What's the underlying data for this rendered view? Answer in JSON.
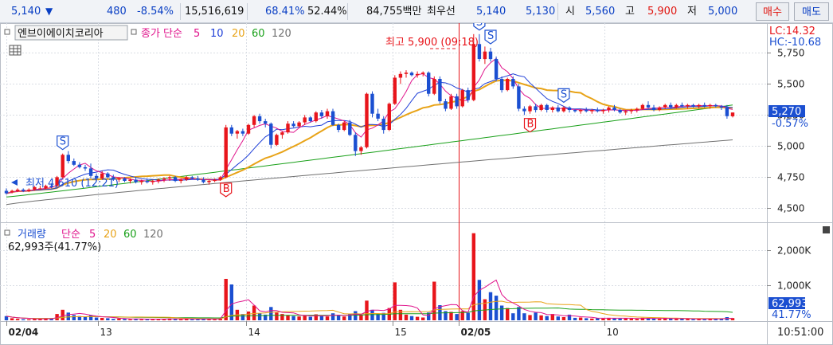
{
  "quote_bar": {
    "price": "5,140",
    "change_arrow": "▼",
    "change": "480",
    "change_pct": "-8.54%",
    "volume": "15,516,619",
    "ratio1": "68.41%",
    "ratio2": "52.44%",
    "amount": "84,755백만",
    "best_label": "최우선",
    "best_ask": "5,140",
    "best_bid": "5,130",
    "open_label": "시",
    "open": "5,560",
    "high_label": "고",
    "high": "5,900",
    "low_label": "저",
    "low": "5,000",
    "buy_button": "매수",
    "sell_button": "매도"
  },
  "price_panel": {
    "stock_name": "엔브이에이치코리아",
    "ma_label": "종가 단순",
    "ma_periods": [
      "5",
      "10",
      "20",
      "60",
      "120"
    ],
    "lc_label": "LC:14.32",
    "hc_label": "HC:-10.68",
    "high_annotation": "최고 5,900 (09:18)",
    "low_annotation": "최저 4,610 (12:21)",
    "current_price_tag": "5,270",
    "current_pct_tag": "-0.57%",
    "y_ticks": [
      "5,750",
      "5,500",
      "5,250",
      "5,000",
      "4,750",
      "4,500"
    ],
    "signal_buy": "B",
    "signal_sell": "S"
  },
  "volume_panel": {
    "title": "거래량",
    "ma_label": "단순",
    "ma_periods": [
      "5",
      "20",
      "60",
      "120"
    ],
    "info": "62,993주(41.77%)",
    "current_tag": "62,993",
    "current_pct_tag": "41.77%",
    "y_ticks": [
      "2,000K",
      "1,000K"
    ]
  },
  "x_axis": {
    "labels": [
      "02/04",
      "13",
      "14",
      "15",
      "02/05",
      "10"
    ],
    "time": "10:51:00"
  },
  "colors": {
    "up": "#e8151b",
    "down": "#1b4fd1",
    "ma5": "#e0148c",
    "ma10": "#2040d8",
    "ma20": "#e8a317",
    "ma60": "#19a019",
    "ma120": "#707070"
  },
  "chart_data": {
    "type": "candlestick",
    "price_ylim": [
      4400,
      5950
    ],
    "volume_ylim": [
      0,
      2700000
    ],
    "candles": [
      {
        "o": 4640,
        "h": 4660,
        "l": 4610,
        "c": 4620,
        "v": 120000
      },
      {
        "o": 4630,
        "h": 4650,
        "l": 4620,
        "c": 4640,
        "v": 60000
      },
      {
        "o": 4640,
        "h": 4660,
        "l": 4630,
        "c": 4650,
        "v": 40000
      },
      {
        "o": 4650,
        "h": 4660,
        "l": 4630,
        "c": 4640,
        "v": 30000
      },
      {
        "o": 4640,
        "h": 4660,
        "l": 4630,
        "c": 4650,
        "v": 30000
      },
      {
        "o": 4650,
        "h": 4680,
        "l": 4640,
        "c": 4670,
        "v": 50000
      },
      {
        "o": 4660,
        "h": 4680,
        "l": 4650,
        "c": 4660,
        "v": 40000
      },
      {
        "o": 4660,
        "h": 4690,
        "l": 4650,
        "c": 4680,
        "v": 60000
      },
      {
        "o": 4680,
        "h": 4700,
        "l": 4660,
        "c": 4670,
        "v": 40000
      },
      {
        "o": 4680,
        "h": 4760,
        "l": 4670,
        "c": 4750,
        "v": 180000
      },
      {
        "o": 4750,
        "h": 4940,
        "l": 4740,
        "c": 4930,
        "v": 300000
      },
      {
        "o": 4930,
        "h": 4960,
        "l": 4860,
        "c": 4880,
        "v": 220000
      },
      {
        "o": 4880,
        "h": 4900,
        "l": 4840,
        "c": 4850,
        "v": 150000
      },
      {
        "o": 4850,
        "h": 4870,
        "l": 4820,
        "c": 4830,
        "v": 120000
      },
      {
        "o": 4830,
        "h": 4850,
        "l": 4800,
        "c": 4820,
        "v": 90000
      },
      {
        "o": 4820,
        "h": 4860,
        "l": 4740,
        "c": 4760,
        "v": 150000
      },
      {
        "o": 4760,
        "h": 4780,
        "l": 4720,
        "c": 4740,
        "v": 80000
      },
      {
        "o": 4740,
        "h": 4800,
        "l": 4730,
        "c": 4780,
        "v": 70000
      },
      {
        "o": 4780,
        "h": 4790,
        "l": 4740,
        "c": 4750,
        "v": 60000
      },
      {
        "o": 4750,
        "h": 4770,
        "l": 4720,
        "c": 4730,
        "v": 40000
      },
      {
        "o": 4730,
        "h": 4750,
        "l": 4710,
        "c": 4740,
        "v": 50000
      },
      {
        "o": 4740,
        "h": 4750,
        "l": 4710,
        "c": 4720,
        "v": 40000
      },
      {
        "o": 4720,
        "h": 4740,
        "l": 4700,
        "c": 4730,
        "v": 30000
      },
      {
        "o": 4730,
        "h": 4750,
        "l": 4700,
        "c": 4710,
        "v": 40000
      },
      {
        "o": 4710,
        "h": 4730,
        "l": 4690,
        "c": 4720,
        "v": 30000
      },
      {
        "o": 4720,
        "h": 4740,
        "l": 4700,
        "c": 4710,
        "v": 30000
      },
      {
        "o": 4710,
        "h": 4730,
        "l": 4690,
        "c": 4720,
        "v": 40000
      },
      {
        "o": 4720,
        "h": 4740,
        "l": 4700,
        "c": 4730,
        "v": 30000
      },
      {
        "o": 4730,
        "h": 4750,
        "l": 4710,
        "c": 4740,
        "v": 40000
      },
      {
        "o": 4740,
        "h": 4760,
        "l": 4720,
        "c": 4750,
        "v": 50000
      },
      {
        "o": 4750,
        "h": 4760,
        "l": 4710,
        "c": 4720,
        "v": 40000
      },
      {
        "o": 4720,
        "h": 4740,
        "l": 4700,
        "c": 4730,
        "v": 30000
      },
      {
        "o": 4730,
        "h": 4760,
        "l": 4720,
        "c": 4750,
        "v": 40000
      },
      {
        "o": 4750,
        "h": 4760,
        "l": 4730,
        "c": 4740,
        "v": 30000
      },
      {
        "o": 4740,
        "h": 4760,
        "l": 4720,
        "c": 4730,
        "v": 30000
      },
      {
        "o": 4730,
        "h": 4750,
        "l": 4700,
        "c": 4710,
        "v": 50000
      },
      {
        "o": 4710,
        "h": 4730,
        "l": 4690,
        "c": 4720,
        "v": 40000
      },
      {
        "o": 4720,
        "h": 4740,
        "l": 4710,
        "c": 4730,
        "v": 30000
      },
      {
        "o": 4730,
        "h": 4760,
        "l": 4720,
        "c": 4750,
        "v": 50000
      },
      {
        "o": 4750,
        "h": 5170,
        "l": 4740,
        "c": 5150,
        "v": 1180000
      },
      {
        "o": 5150,
        "h": 5170,
        "l": 5080,
        "c": 5100,
        "v": 1020000
      },
      {
        "o": 5100,
        "h": 5130,
        "l": 5060,
        "c": 5120,
        "v": 300000
      },
      {
        "o": 5120,
        "h": 5140,
        "l": 5080,
        "c": 5100,
        "v": 180000
      },
      {
        "o": 5100,
        "h": 5180,
        "l": 5090,
        "c": 5170,
        "v": 250000
      },
      {
        "o": 5170,
        "h": 5250,
        "l": 5150,
        "c": 5240,
        "v": 420000
      },
      {
        "o": 5240,
        "h": 5260,
        "l": 5180,
        "c": 5200,
        "v": 200000
      },
      {
        "o": 5200,
        "h": 5220,
        "l": 5150,
        "c": 5180,
        "v": 160000
      },
      {
        "o": 5180,
        "h": 5190,
        "l": 4980,
        "c": 5010,
        "v": 380000
      },
      {
        "o": 5010,
        "h": 5100,
        "l": 5000,
        "c": 5090,
        "v": 220000
      },
      {
        "o": 5090,
        "h": 5120,
        "l": 5060,
        "c": 5110,
        "v": 180000
      },
      {
        "o": 5110,
        "h": 5200,
        "l": 5100,
        "c": 5180,
        "v": 150000
      },
      {
        "o": 5180,
        "h": 5200,
        "l": 5150,
        "c": 5160,
        "v": 120000
      },
      {
        "o": 5160,
        "h": 5200,
        "l": 5150,
        "c": 5190,
        "v": 110000
      },
      {
        "o": 5190,
        "h": 5250,
        "l": 5170,
        "c": 5230,
        "v": 130000
      },
      {
        "o": 5230,
        "h": 5240,
        "l": 5190,
        "c": 5200,
        "v": 100000
      },
      {
        "o": 5200,
        "h": 5280,
        "l": 5190,
        "c": 5270,
        "v": 170000
      },
      {
        "o": 5270,
        "h": 5290,
        "l": 5220,
        "c": 5240,
        "v": 120000
      },
      {
        "o": 5240,
        "h": 5300,
        "l": 5220,
        "c": 5280,
        "v": 110000
      },
      {
        "o": 5280,
        "h": 5300,
        "l": 5160,
        "c": 5170,
        "v": 200000
      },
      {
        "o": 5170,
        "h": 5180,
        "l": 5110,
        "c": 5130,
        "v": 140000
      },
      {
        "o": 5130,
        "h": 5200,
        "l": 5120,
        "c": 5190,
        "v": 110000
      },
      {
        "o": 5190,
        "h": 5210,
        "l": 5080,
        "c": 5090,
        "v": 180000
      },
      {
        "o": 5090,
        "h": 5110,
        "l": 4920,
        "c": 4960,
        "v": 260000
      },
      {
        "o": 4960,
        "h": 5000,
        "l": 4930,
        "c": 4990,
        "v": 150000
      },
      {
        "o": 4990,
        "h": 5430,
        "l": 4980,
        "c": 5420,
        "v": 560000
      },
      {
        "o": 5420,
        "h": 5440,
        "l": 5230,
        "c": 5260,
        "v": 300000
      },
      {
        "o": 5260,
        "h": 5300,
        "l": 5200,
        "c": 5220,
        "v": 180000
      },
      {
        "o": 5220,
        "h": 5240,
        "l": 5100,
        "c": 5130,
        "v": 210000
      },
      {
        "o": 5130,
        "h": 5350,
        "l": 5120,
        "c": 5340,
        "v": 350000
      },
      {
        "o": 5340,
        "h": 5570,
        "l": 5330,
        "c": 5550,
        "v": 1080000
      },
      {
        "o": 5550,
        "h": 5600,
        "l": 5500,
        "c": 5580,
        "v": 300000
      },
      {
        "o": 5580,
        "h": 5610,
        "l": 5550,
        "c": 5590,
        "v": 160000
      },
      {
        "o": 5590,
        "h": 5600,
        "l": 5560,
        "c": 5570,
        "v": 120000
      },
      {
        "o": 5570,
        "h": 5600,
        "l": 5550,
        "c": 5580,
        "v": 100000
      },
      {
        "o": 5580,
        "h": 5600,
        "l": 5560,
        "c": 5590,
        "v": 80000
      },
      {
        "o": 5590,
        "h": 5600,
        "l": 5400,
        "c": 5420,
        "v": 220000
      },
      {
        "o": 5420,
        "h": 5560,
        "l": 5410,
        "c": 5540,
        "v": 1100000
      },
      {
        "o": 5540,
        "h": 5560,
        "l": 5340,
        "c": 5360,
        "v": 430000
      },
      {
        "o": 5360,
        "h": 5380,
        "l": 5280,
        "c": 5300,
        "v": 260000
      },
      {
        "o": 5300,
        "h": 5420,
        "l": 5290,
        "c": 5400,
        "v": 240000
      },
      {
        "o": 5400,
        "h": 5420,
        "l": 5300,
        "c": 5320,
        "v": 180000
      },
      {
        "o": 5320,
        "h": 5460,
        "l": 5310,
        "c": 5450,
        "v": 260000
      },
      {
        "o": 5450,
        "h": 5470,
        "l": 5350,
        "c": 5370,
        "v": 210000
      },
      {
        "o": 5370,
        "h": 5900,
        "l": 5360,
        "c": 5820,
        "v": 2480000
      },
      {
        "o": 5820,
        "h": 5900,
        "l": 5680,
        "c": 5700,
        "v": 1150000
      },
      {
        "o": 5700,
        "h": 5800,
        "l": 5660,
        "c": 5760,
        "v": 600000
      },
      {
        "o": 5760,
        "h": 5790,
        "l": 5680,
        "c": 5700,
        "v": 800000
      },
      {
        "o": 5700,
        "h": 5720,
        "l": 5520,
        "c": 5540,
        "v": 700000
      },
      {
        "o": 5540,
        "h": 5560,
        "l": 5430,
        "c": 5450,
        "v": 420000
      },
      {
        "o": 5450,
        "h": 5550,
        "l": 5440,
        "c": 5540,
        "v": 350000
      },
      {
        "o": 5540,
        "h": 5560,
        "l": 5460,
        "c": 5480,
        "v": 200000
      },
      {
        "o": 5480,
        "h": 5500,
        "l": 5280,
        "c": 5300,
        "v": 380000
      },
      {
        "o": 5300,
        "h": 5320,
        "l": 5250,
        "c": 5280,
        "v": 200000
      },
      {
        "o": 5280,
        "h": 5330,
        "l": 5260,
        "c": 5320,
        "v": 150000
      },
      {
        "o": 5320,
        "h": 5340,
        "l": 5270,
        "c": 5290,
        "v": 220000
      },
      {
        "o": 5290,
        "h": 5340,
        "l": 5280,
        "c": 5330,
        "v": 140000
      },
      {
        "o": 5330,
        "h": 5340,
        "l": 5270,
        "c": 5290,
        "v": 120000
      },
      {
        "o": 5290,
        "h": 5320,
        "l": 5270,
        "c": 5310,
        "v": 180000
      },
      {
        "o": 5310,
        "h": 5330,
        "l": 5270,
        "c": 5280,
        "v": 110000
      },
      {
        "o": 5280,
        "h": 5320,
        "l": 5270,
        "c": 5310,
        "v": 90000
      },
      {
        "o": 5310,
        "h": 5320,
        "l": 5270,
        "c": 5290,
        "v": 160000
      },
      {
        "o": 5290,
        "h": 5300,
        "l": 5270,
        "c": 5280,
        "v": 70000
      },
      {
        "o": 5280,
        "h": 5300,
        "l": 5260,
        "c": 5290,
        "v": 80000
      },
      {
        "o": 5290,
        "h": 5310,
        "l": 5270,
        "c": 5280,
        "v": 60000
      },
      {
        "o": 5280,
        "h": 5300,
        "l": 5260,
        "c": 5290,
        "v": 50000
      },
      {
        "o": 5290,
        "h": 5310,
        "l": 5270,
        "c": 5280,
        "v": 60000
      },
      {
        "o": 5280,
        "h": 5300,
        "l": 5260,
        "c": 5290,
        "v": 50000
      },
      {
        "o": 5290,
        "h": 5320,
        "l": 5270,
        "c": 5310,
        "v": 70000
      },
      {
        "o": 5310,
        "h": 5330,
        "l": 5280,
        "c": 5290,
        "v": 60000
      },
      {
        "o": 5290,
        "h": 5300,
        "l": 5260,
        "c": 5270,
        "v": 50000
      },
      {
        "o": 5270,
        "h": 5290,
        "l": 5250,
        "c": 5280,
        "v": 60000
      },
      {
        "o": 5280,
        "h": 5300,
        "l": 5260,
        "c": 5290,
        "v": 50000
      },
      {
        "o": 5290,
        "h": 5310,
        "l": 5270,
        "c": 5300,
        "v": 40000
      },
      {
        "o": 5300,
        "h": 5340,
        "l": 5290,
        "c": 5330,
        "v": 70000
      },
      {
        "o": 5330,
        "h": 5360,
        "l": 5300,
        "c": 5310,
        "v": 60000
      },
      {
        "o": 5310,
        "h": 5330,
        "l": 5280,
        "c": 5290,
        "v": 50000
      },
      {
        "o": 5290,
        "h": 5320,
        "l": 5280,
        "c": 5310,
        "v": 40000
      },
      {
        "o": 5310,
        "h": 5340,
        "l": 5300,
        "c": 5330,
        "v": 60000
      },
      {
        "o": 5330,
        "h": 5350,
        "l": 5300,
        "c": 5310,
        "v": 50000
      },
      {
        "o": 5310,
        "h": 5340,
        "l": 5300,
        "c": 5330,
        "v": 40000
      },
      {
        "o": 5330,
        "h": 5350,
        "l": 5310,
        "c": 5320,
        "v": 50000
      },
      {
        "o": 5320,
        "h": 5340,
        "l": 5300,
        "c": 5330,
        "v": 40000
      },
      {
        "o": 5330,
        "h": 5340,
        "l": 5310,
        "c": 5320,
        "v": 30000
      },
      {
        "o": 5320,
        "h": 5340,
        "l": 5300,
        "c": 5330,
        "v": 40000
      },
      {
        "o": 5330,
        "h": 5350,
        "l": 5310,
        "c": 5320,
        "v": 30000
      },
      {
        "o": 5320,
        "h": 5340,
        "l": 5300,
        "c": 5330,
        "v": 50000
      },
      {
        "o": 5330,
        "h": 5340,
        "l": 5310,
        "c": 5320,
        "v": 40000
      },
      {
        "o": 5320,
        "h": 5330,
        "l": 5290,
        "c": 5310,
        "v": 50000
      },
      {
        "o": 5310,
        "h": 5330,
        "l": 5220,
        "c": 5240,
        "v": 90000
      },
      {
        "o": 5240,
        "h": 5270,
        "l": 5230,
        "c": 5270,
        "v": 63000
      }
    ],
    "ma60_endpoints": [
      4590,
      5330
    ],
    "ma120_endpoints": [
      4530,
      5050
    ]
  }
}
